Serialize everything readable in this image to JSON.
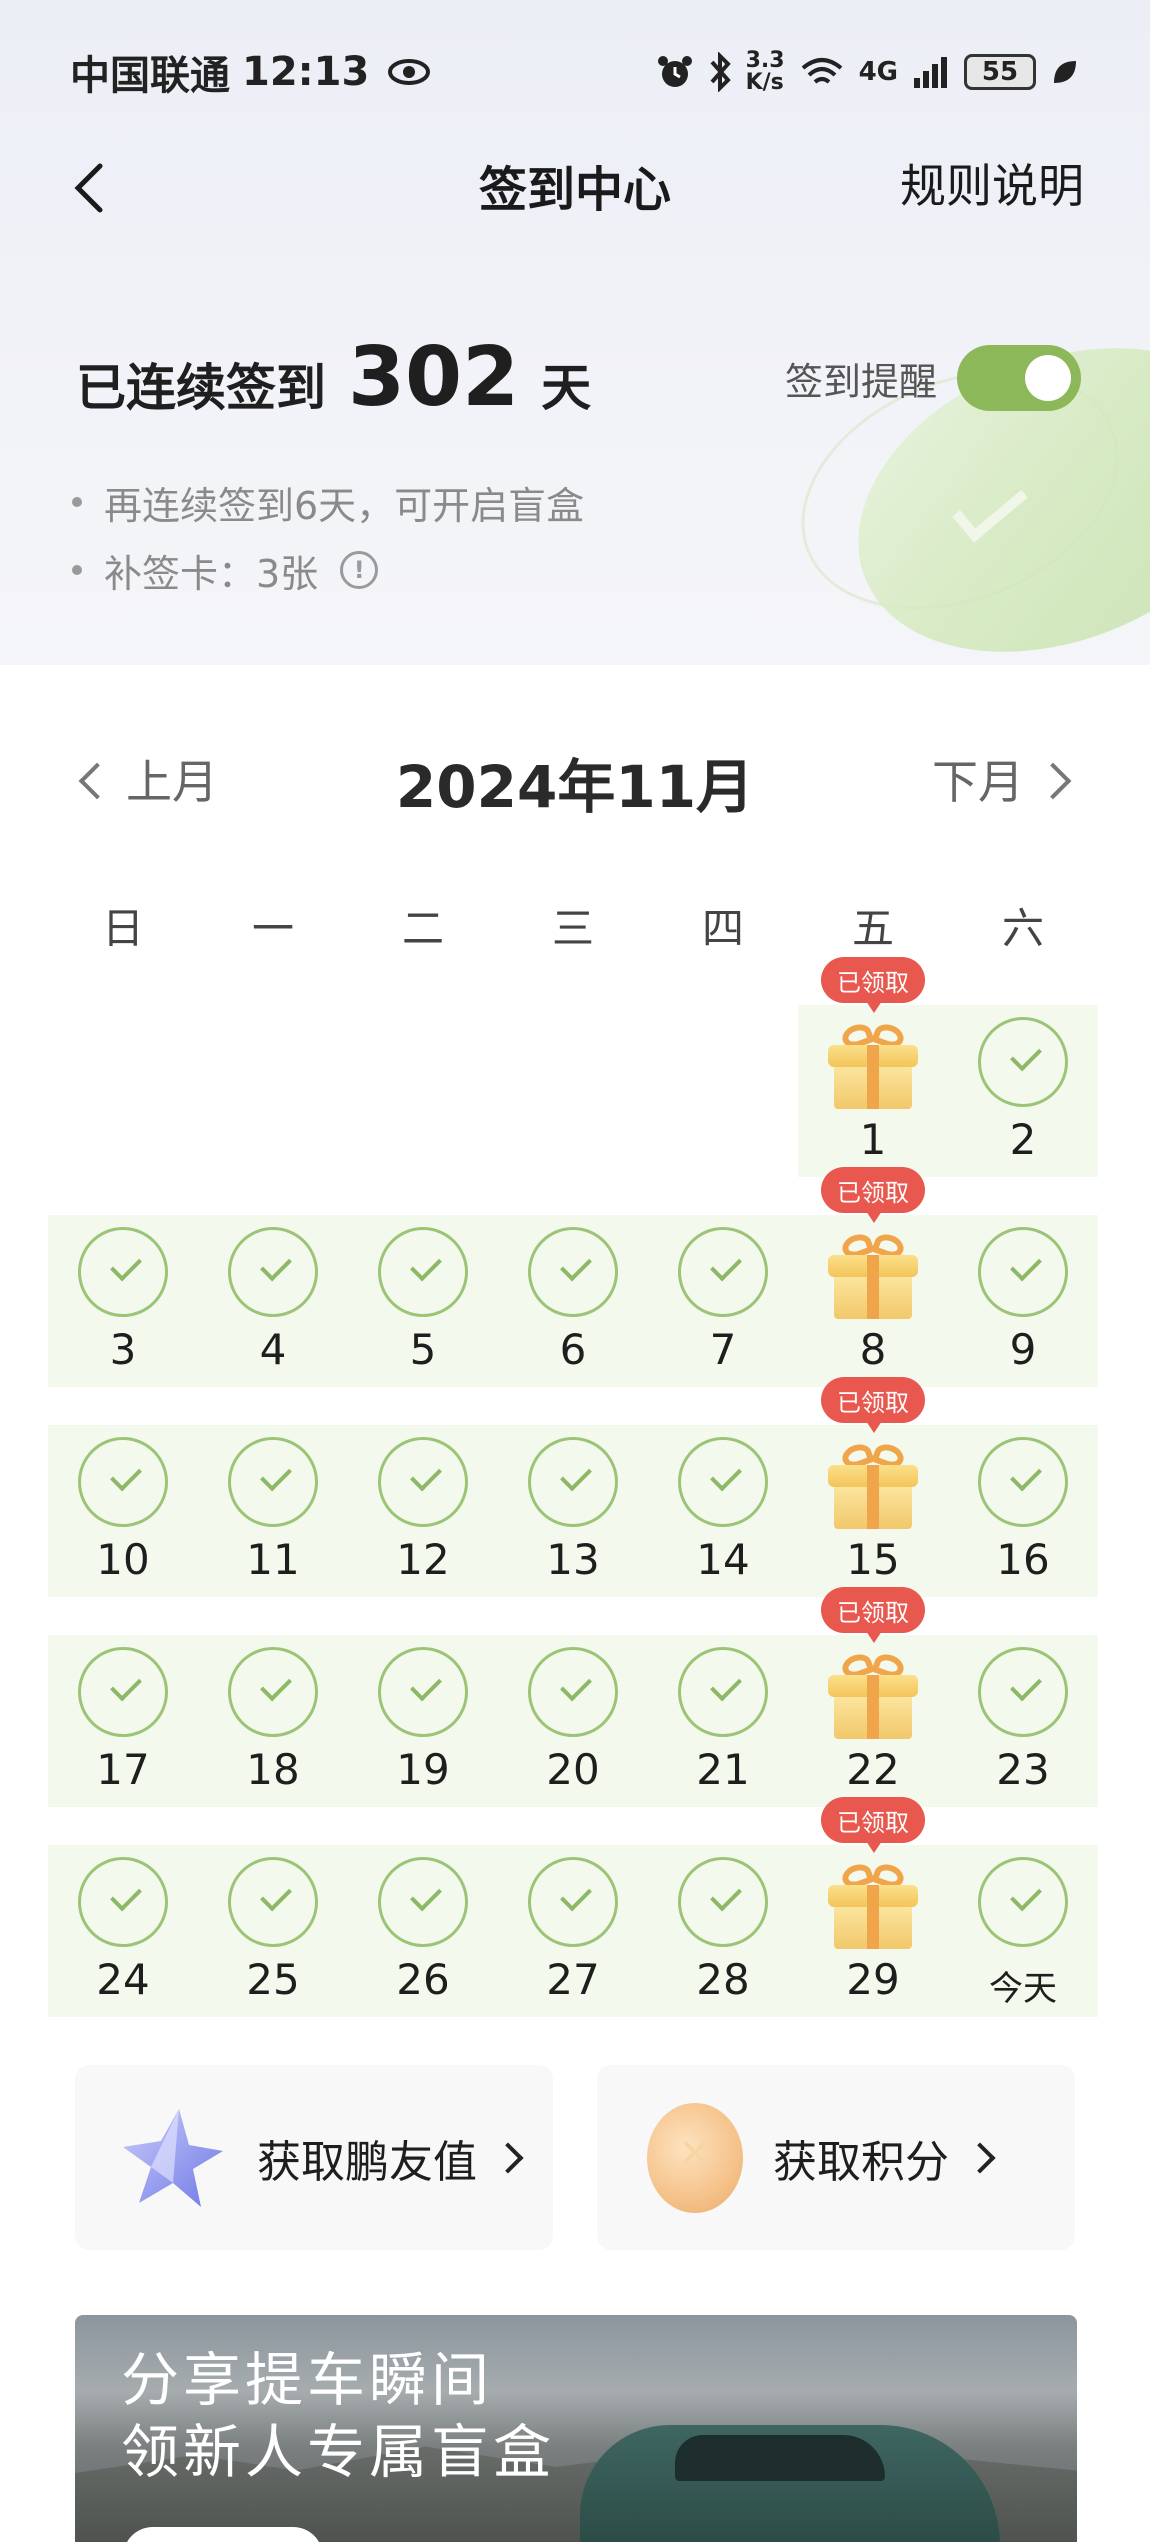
{
  "status_bar": {
    "carrier": "中国联通",
    "time": "12:13",
    "net_speed_top": "3.3",
    "net_speed_bottom": "K/s",
    "signal": "4G",
    "battery": "55"
  },
  "nav": {
    "title": "签到中心",
    "rules": "规则说明"
  },
  "streak": {
    "prefix": "已连续签到",
    "days": "302",
    "suffix": "天",
    "reminder_label": "签到提醒",
    "reminder_on": true,
    "tips": [
      "再连续签到6天，可开启盲盒",
      "补签卡：3张"
    ]
  },
  "calendar": {
    "prev": "上月",
    "next": "下月",
    "title": "2024年11月",
    "weekdays": [
      "日",
      "一",
      "二",
      "三",
      "四",
      "五",
      "六"
    ],
    "claimed_label": "已领取",
    "today_label": "今天",
    "weeks": [
      [
        "",
        "",
        "",
        "",
        "",
        "1",
        "2"
      ],
      [
        "3",
        "4",
        "5",
        "6",
        "7",
        "8",
        "9"
      ],
      [
        "10",
        "11",
        "12",
        "13",
        "14",
        "15",
        "16"
      ],
      [
        "17",
        "18",
        "19",
        "20",
        "21",
        "22",
        "23"
      ],
      [
        "24",
        "25",
        "26",
        "27",
        "28",
        "29",
        "今天"
      ]
    ]
  },
  "actions": {
    "friend_value": "获取鹏友值",
    "points": "获取积分"
  },
  "banner": {
    "line1": "分享提车瞬间",
    "line2": "领新人专属盲盒"
  },
  "colors": {
    "accent_green": "#8cb85a",
    "row_bg": "#f4f9ed",
    "badge_red": "#e8584f"
  }
}
